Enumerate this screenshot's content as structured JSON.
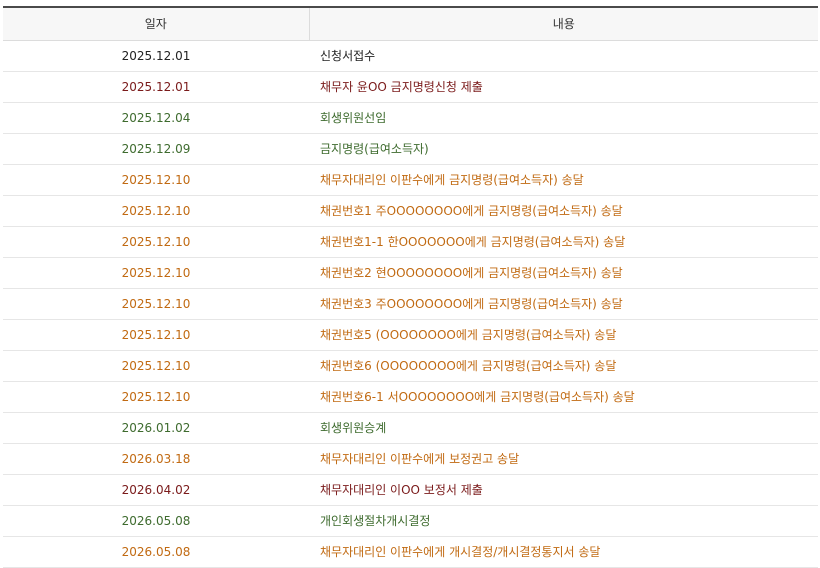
{
  "table": {
    "headers": {
      "date": "일자",
      "content": "내용"
    },
    "status_colors": {
      "black": "#222222",
      "maroon": "#7a1a1a",
      "green": "#3e6b2e",
      "orange": "#c16a12"
    },
    "rows": [
      {
        "date": "2025.12.01",
        "content": "신청서접수",
        "status": "black"
      },
      {
        "date": "2025.12.01",
        "content": "채무자 윤OO 금지명령신청 제출",
        "status": "maroon"
      },
      {
        "date": "2025.12.04",
        "content": "회생위원선임",
        "status": "green"
      },
      {
        "date": "2025.12.09",
        "content": "금지명령(급여소득자)",
        "status": "green"
      },
      {
        "date": "2025.12.10",
        "content": "채무자대리인 이판수에게 금지명령(급여소득자) 송달",
        "status": "orange"
      },
      {
        "date": "2025.12.10",
        "content": "채권번호1 주OOOOOOOO에게 금지명령(급여소득자) 송달",
        "status": "orange"
      },
      {
        "date": "2025.12.10",
        "content": "채권번호1-1 한OOOOOOO에게 금지명령(급여소득자) 송달",
        "status": "orange"
      },
      {
        "date": "2025.12.10",
        "content": "채권번호2 현OOOOOOOO에게 금지명령(급여소득자) 송달",
        "status": "orange"
      },
      {
        "date": "2025.12.10",
        "content": "채권번호3 주OOOOOOOO에게 금지명령(급여소득자) 송달",
        "status": "orange"
      },
      {
        "date": "2025.12.10",
        "content": "채권번호5 (OOOOOOOO에게 금지명령(급여소득자) 송달",
        "status": "orange"
      },
      {
        "date": "2025.12.10",
        "content": "채권번호6 (OOOOOOOO에게 금지명령(급여소득자) 송달",
        "status": "orange"
      },
      {
        "date": "2025.12.10",
        "content": "채권번호6-1 서OOOOOOOO에게 금지명령(급여소득자) 송달",
        "status": "orange"
      },
      {
        "date": "2026.01.02",
        "content": "회생위원승계",
        "status": "green"
      },
      {
        "date": "2026.03.18",
        "content": "채무자대리인 이판수에게 보정권고 송달",
        "status": "orange"
      },
      {
        "date": "2026.04.02",
        "content": "채무자대리인 이OO 보정서 제출",
        "status": "maroon"
      },
      {
        "date": "2026.05.08",
        "content": "개인회생절차개시결정",
        "status": "green"
      },
      {
        "date": "2026.05.08",
        "content": "채무자대리인 이판수에게 개시결정/개시결정통지서 송달",
        "status": "orange"
      }
    ]
  }
}
